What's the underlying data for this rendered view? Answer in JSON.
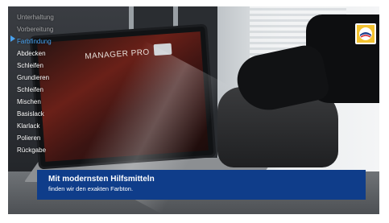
{
  "menu": {
    "items": [
      {
        "label": "Unterhaltung",
        "state": "dim"
      },
      {
        "label": "Vorbereitung",
        "state": "dim"
      },
      {
        "label": "Farbfindung",
        "state": "active"
      },
      {
        "label": "Abdecken",
        "state": "normal"
      },
      {
        "label": "Schleifen",
        "state": "normal"
      },
      {
        "label": "Grundieren",
        "state": "normal"
      },
      {
        "label": "Schleifen",
        "state": "normal"
      },
      {
        "label": "Mischen",
        "state": "normal"
      },
      {
        "label": "Basislack",
        "state": "normal"
      },
      {
        "label": "Klarlack",
        "state": "normal"
      },
      {
        "label": "Polieren",
        "state": "normal"
      },
      {
        "label": "Rückgabe",
        "state": "normal"
      }
    ],
    "active_color": "#4aa3f0"
  },
  "screen": {
    "title": "MANAGER PRO"
  },
  "caption": {
    "title": "Mit modernsten Hilfsmitteln",
    "subtitle": "finden wir den exakten Farbton.",
    "background": "#0f3d8a"
  },
  "logo": {
    "icon": "brand-logo-icon",
    "color": "#f2c230"
  }
}
